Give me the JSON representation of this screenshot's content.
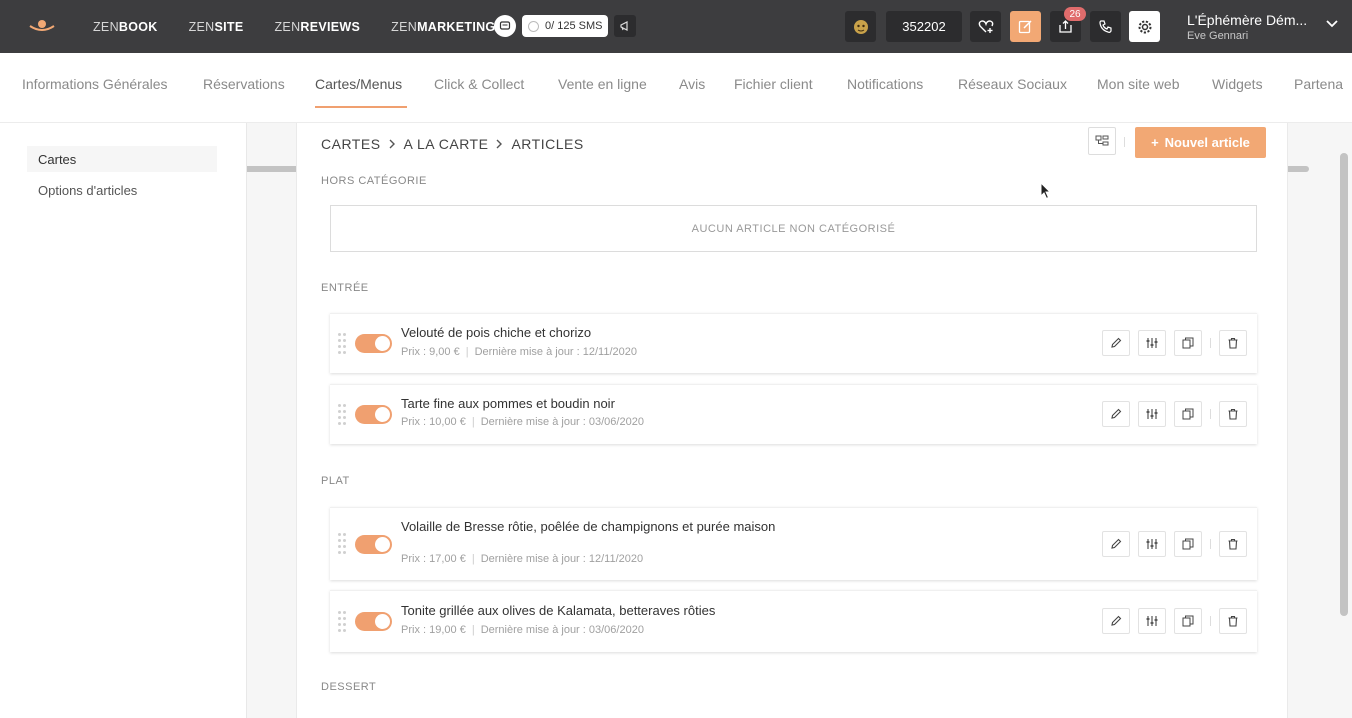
{
  "topbar": {
    "nav": [
      {
        "prefix": "ZEN",
        "bold": "BOOK"
      },
      {
        "prefix": "ZEN",
        "bold": "SITE"
      },
      {
        "prefix": "ZEN",
        "bold": "REVIEWS"
      },
      {
        "prefix": "ZEN",
        "bold": "MARKETING"
      }
    ],
    "sms_label": "0/ 125 SMS",
    "restaurant_id": "352202",
    "notification_count": "26",
    "account_name": "L'Éphémère Dém...",
    "account_user": "Eve Gennari",
    "accent_color": "#f2a874"
  },
  "tabs": [
    "Informations Générales",
    "Réservations",
    "Cartes/Menus",
    "Click & Collect",
    "Vente en ligne",
    "Avis",
    "Fichier client",
    "Notifications",
    "Réseaux Sociaux",
    "Mon site web",
    "Widgets",
    "Partena"
  ],
  "active_tab": "Cartes/Menus",
  "sidebar": {
    "items": [
      "Cartes",
      "Options d'articles"
    ],
    "active": "Cartes"
  },
  "main": {
    "breadcrumb": [
      "CARTES",
      "A LA CARTE",
      "ARTICLES"
    ],
    "new_button": "Nouvel article",
    "sections": {
      "uncategorized": "HORS CATÉGORIE",
      "uncategorized_empty": "AUCUN ARTICLE NON CATÉGORISÉ",
      "entree": "ENTRÉE",
      "plat": "PLAT",
      "dessert": "DESSERT"
    },
    "articles": [
      {
        "name": "Velouté de pois chiche et chorizo",
        "price": "Prix :  9,00 €",
        "updated": "Dernière mise à jour : 12/11/2020",
        "enabled": true
      },
      {
        "name": "Tarte fine aux pommes et boudin noir",
        "price": "Prix :  10,00 €",
        "updated": "Dernière mise à jour : 03/06/2020",
        "enabled": true
      },
      {
        "name": "Volaille de Bresse rôtie, poêlée de champignons et purée maison",
        "price": "Prix :  17,00 €",
        "updated": "Dernière mise à jour : 12/11/2020",
        "enabled": true
      },
      {
        "name": "Tonite grillée aux olives de Kalamata, betteraves rôties",
        "price": "Prix :  19,00 €",
        "updated": "Dernière mise à jour : 03/06/2020",
        "enabled": true
      }
    ]
  }
}
